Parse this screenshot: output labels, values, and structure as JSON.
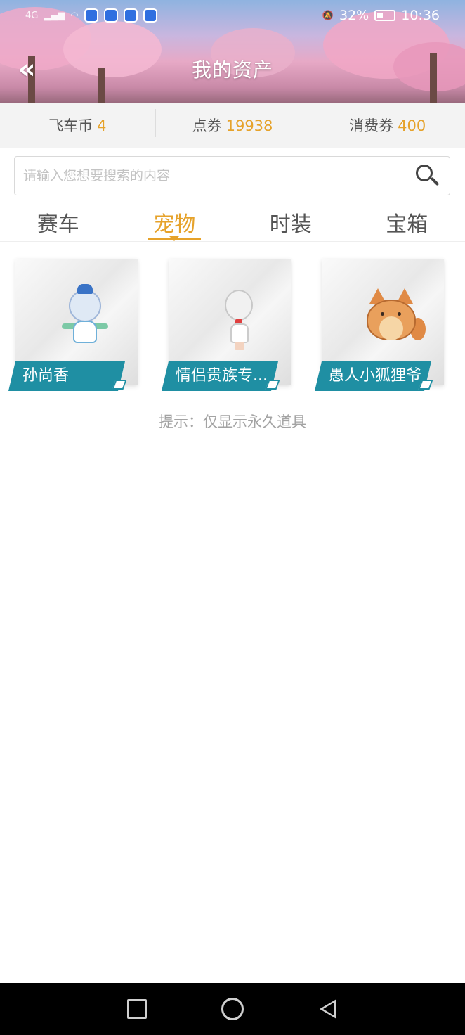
{
  "status_bar": {
    "left_network_label": "4G",
    "battery_percent": "32%",
    "time": "10:36"
  },
  "header": {
    "title": "我的资产",
    "back_icon": "double-chevron-left-icon"
  },
  "currencies": [
    {
      "label": "飞车币",
      "value": "4"
    },
    {
      "label": "点券",
      "value": "19938"
    },
    {
      "label": "消费券",
      "value": "400"
    }
  ],
  "search": {
    "placeholder": "请输入您想要搜索的内容",
    "icon": "search-icon"
  },
  "tabs": [
    {
      "label": "赛车",
      "active": false
    },
    {
      "label": "宠物",
      "active": true
    },
    {
      "label": "时装",
      "active": false
    },
    {
      "label": "宝箱",
      "active": false
    }
  ],
  "items": [
    {
      "name": "孙尚香"
    },
    {
      "name": "情侣贵族专..."
    },
    {
      "name": "愚人小狐狸爷"
    }
  ],
  "hint": "提示：仅显示永久道具",
  "colors": {
    "accent": "#e6a22a",
    "label_bg": "#1f8fa3",
    "hint_text": "#a3a3a3"
  }
}
